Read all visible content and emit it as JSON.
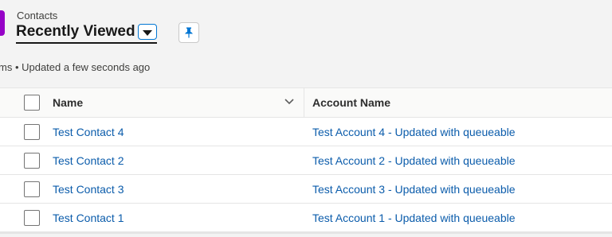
{
  "header": {
    "object_label": "Contacts",
    "list_view_title": "Recently Viewed",
    "icons": {
      "object": "contact-object-icon",
      "switch": "chevron-down-icon",
      "pin": "pin-icon"
    },
    "brand_color": "#9602c7"
  },
  "status": {
    "text": "ms • Updated a few seconds ago"
  },
  "table": {
    "columns": [
      {
        "label": "Name"
      },
      {
        "label": "Account Name"
      }
    ],
    "rows": [
      {
        "name": "Test Contact 4",
        "account": "Test Account 4 - Updated with queueable"
      },
      {
        "name": "Test Contact 2",
        "account": "Test Account 2 - Updated with queueable"
      },
      {
        "name": "Test Contact 3",
        "account": "Test Account 3 - Updated with queueable"
      },
      {
        "name": "Test Contact 1",
        "account": "Test Account 1 - Updated with queueable"
      }
    ]
  }
}
